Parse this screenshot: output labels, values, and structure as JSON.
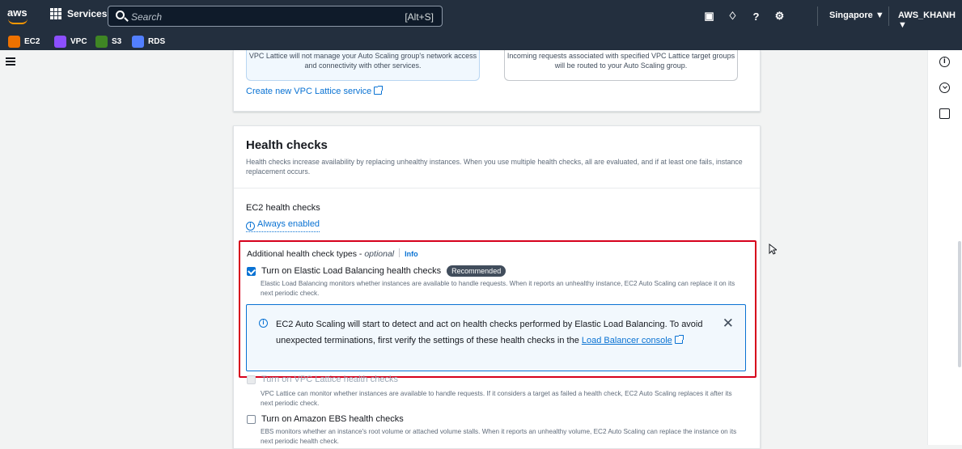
{
  "topbar": {
    "logo": "aws",
    "services_label": "Services",
    "search_placeholder": "Search",
    "search_shortcut": "[Alt+S]",
    "region": "Singapore ▼",
    "account": "AWS_KHANH ▼",
    "icons": [
      "cloudshell-icon",
      "bell-icon",
      "help-icon",
      "settings-icon"
    ]
  },
  "favorites": [
    {
      "label": "EC2",
      "color": "#ed7100",
      "icon": "ec2-icon"
    },
    {
      "label": "VPC",
      "color": "#8c4fff",
      "icon": "vpc-icon"
    },
    {
      "label": "S3",
      "color": "#3f8624",
      "icon": "s3-icon"
    },
    {
      "label": "RDS",
      "color": "#527fff",
      "icon": "rds-icon"
    }
  ],
  "lattice": {
    "option1_text": "VPC Lattice will not manage your Auto Scaling group's network access and connectivity with other services.",
    "option2_text": "Incoming requests associated with specified VPC Lattice target groups will be routed to your Auto Scaling group.",
    "create_link": "Create new VPC Lattice service"
  },
  "health_checks": {
    "title": "Health checks",
    "description": "Health checks increase availability by replacing unhealthy instances. When you use multiple health checks, all are evaluated, and if at least one fails, instance replacement occurs.",
    "ec2_title": "EC2 health checks",
    "always_enabled": "Always enabled",
    "additional_label": "Additional health check types - ",
    "optional": "optional",
    "info": "Info",
    "elb": {
      "label": "Turn on Elastic Load Balancing health checks",
      "badge": "Recommended",
      "checked": true,
      "description": "Elastic Load Balancing monitors whether instances are available to handle requests. When it reports an unhealthy instance, EC2 Auto Scaling can replace it on its next periodic check."
    },
    "alert": {
      "text": "EC2 Auto Scaling will start to detect and act on health checks performed by Elastic Load Balancing. To avoid unexpected terminations, first verify the settings of these health checks in the ",
      "link": "Load Balancer console"
    },
    "lattice_check": {
      "label": "Turn on VPC Lattice health checks",
      "description": "VPC Lattice can monitor whether instances are available to handle requests. If it considers a target as failed a health check, EC2 Auto Scaling replaces it after its next periodic check."
    },
    "ebs": {
      "label": "Turn on Amazon EBS health checks",
      "checked": false,
      "description": "EBS monitors whether an instance's root volume or attached volume stalls. When it reports an unhealthy volume, EC2 Auto Scaling can replace the instance on its next periodic health check."
    }
  }
}
